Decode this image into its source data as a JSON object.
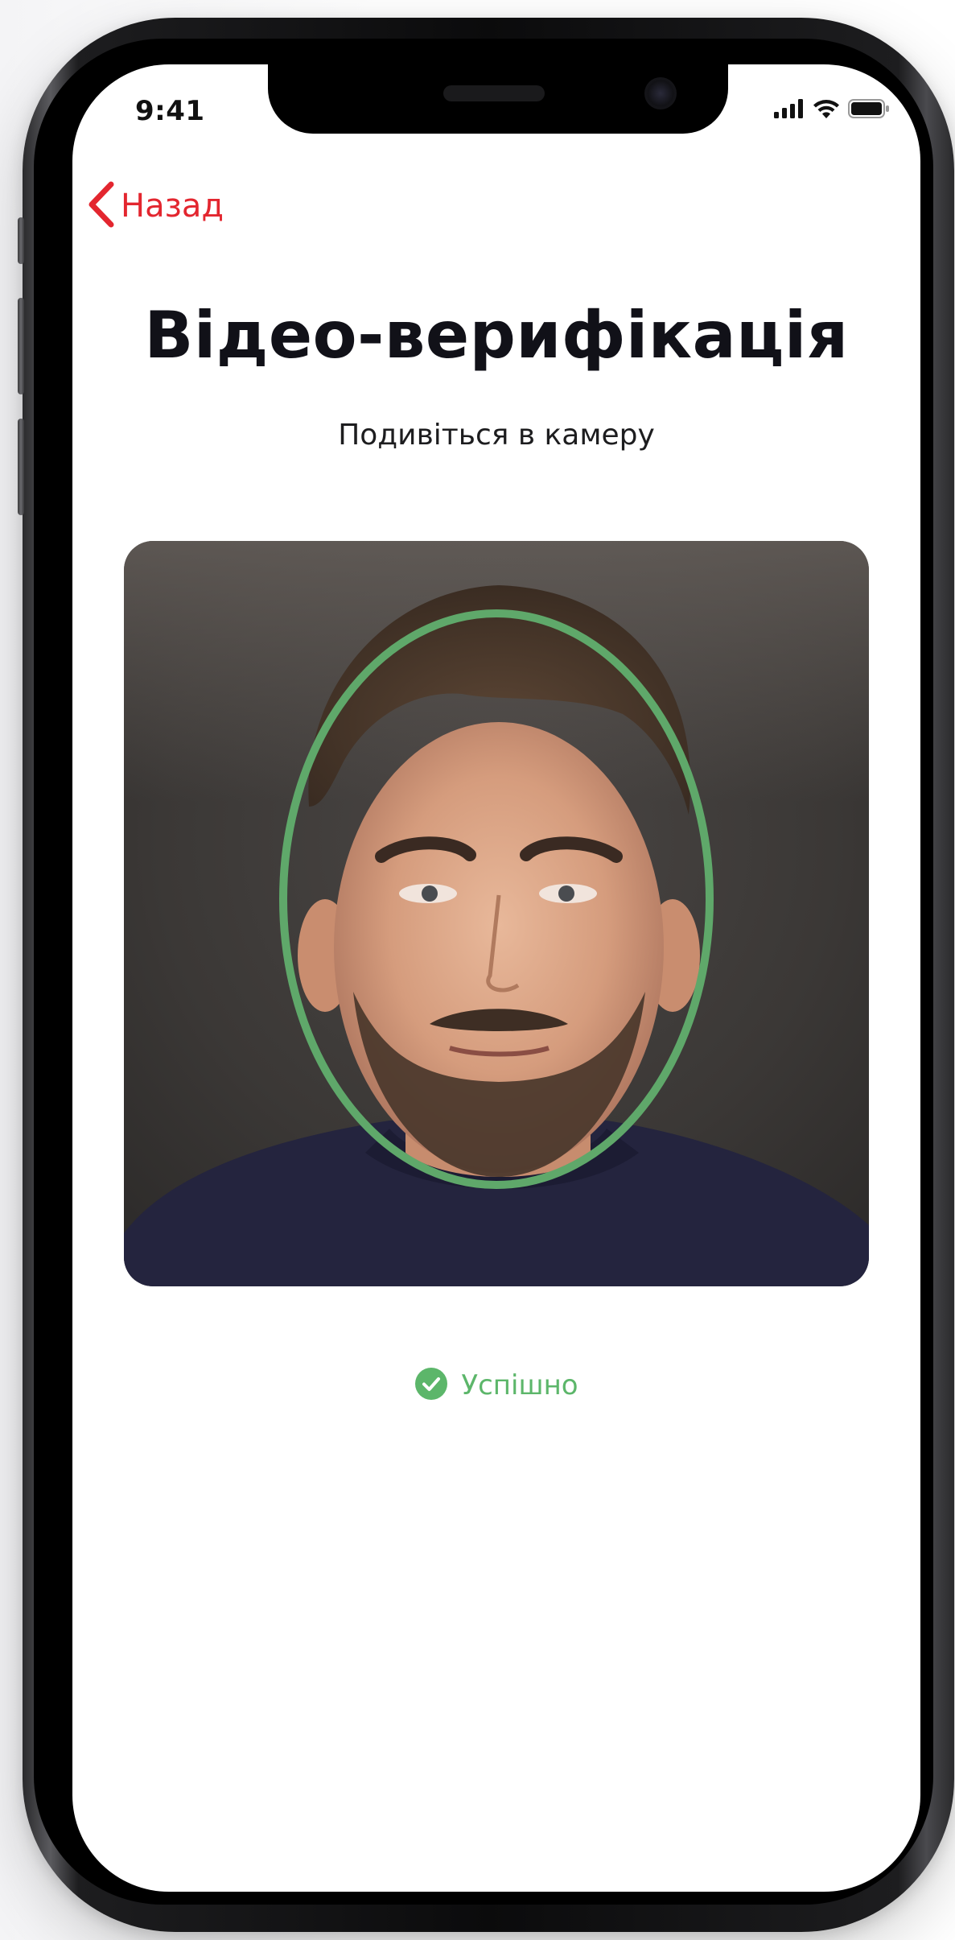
{
  "status_bar": {
    "time": "9:41",
    "icons": [
      "cellular-signal-icon",
      "wifi-icon",
      "battery-icon"
    ]
  },
  "nav": {
    "back_label": "Назад",
    "back_icon": "chevron-left-icon"
  },
  "header": {
    "title": "Відео-верифікація",
    "subtitle": "Подивіться в камеру"
  },
  "camera": {
    "face_guide_color": "#5fa86a"
  },
  "result": {
    "icon": "check-circle-icon",
    "text": "Успішно"
  },
  "colors": {
    "accent": "#e3262f",
    "success": "#5cb66a",
    "title": "#111118"
  }
}
